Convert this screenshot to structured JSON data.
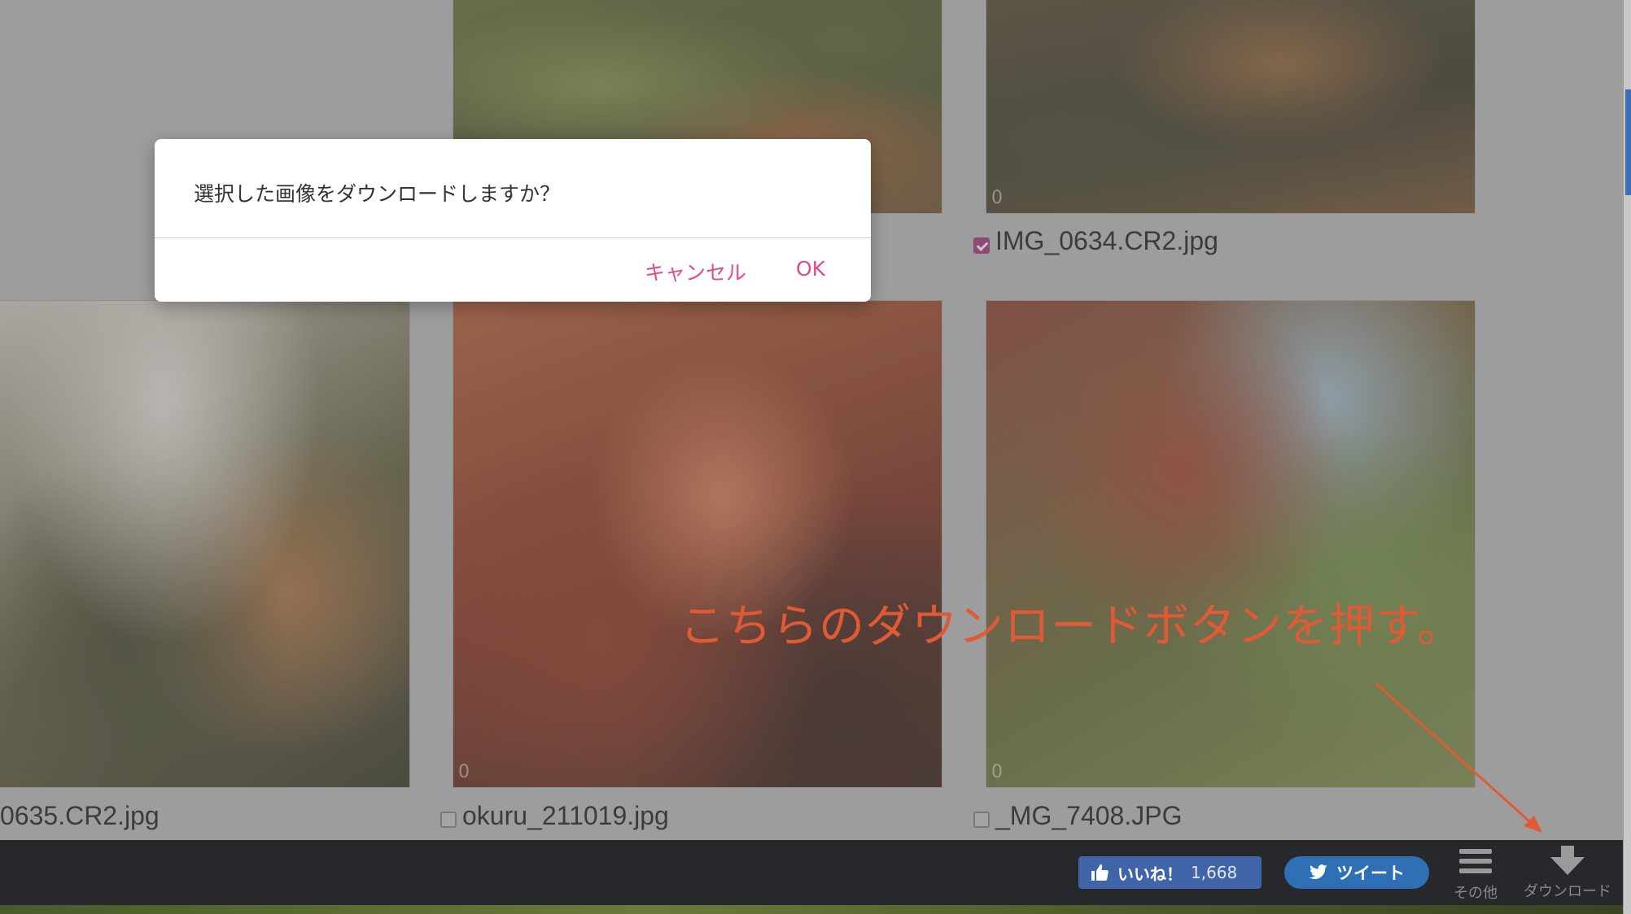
{
  "gallery": {
    "items": [
      {
        "filename": "",
        "count": "",
        "checked": false
      },
      {
        "filename": "IMG_0634.CR2.jpg",
        "count": "0",
        "checked": true
      },
      {
        "filename": "0635.CR2.jpg",
        "count": "",
        "checked": false
      },
      {
        "filename": "okuru_211019.jpg",
        "count": "0",
        "checked": false
      },
      {
        "filename": "_MG_7408.JPG",
        "count": "0",
        "checked": false
      }
    ]
  },
  "dialog": {
    "message": "選択した画像をダウンロードしますか？",
    "cancel_label": "キャンセル",
    "ok_label": "OK",
    "accent_color": "#e04a8e"
  },
  "annotation": {
    "text": "こちらのダウンロードボタンを押す。",
    "color": "#e05a35"
  },
  "bottombar": {
    "like_label": "いいね！",
    "like_count": "1,668",
    "tweet_label": "ツイート",
    "other_label": "その他",
    "download_label": "ダウンロード"
  }
}
